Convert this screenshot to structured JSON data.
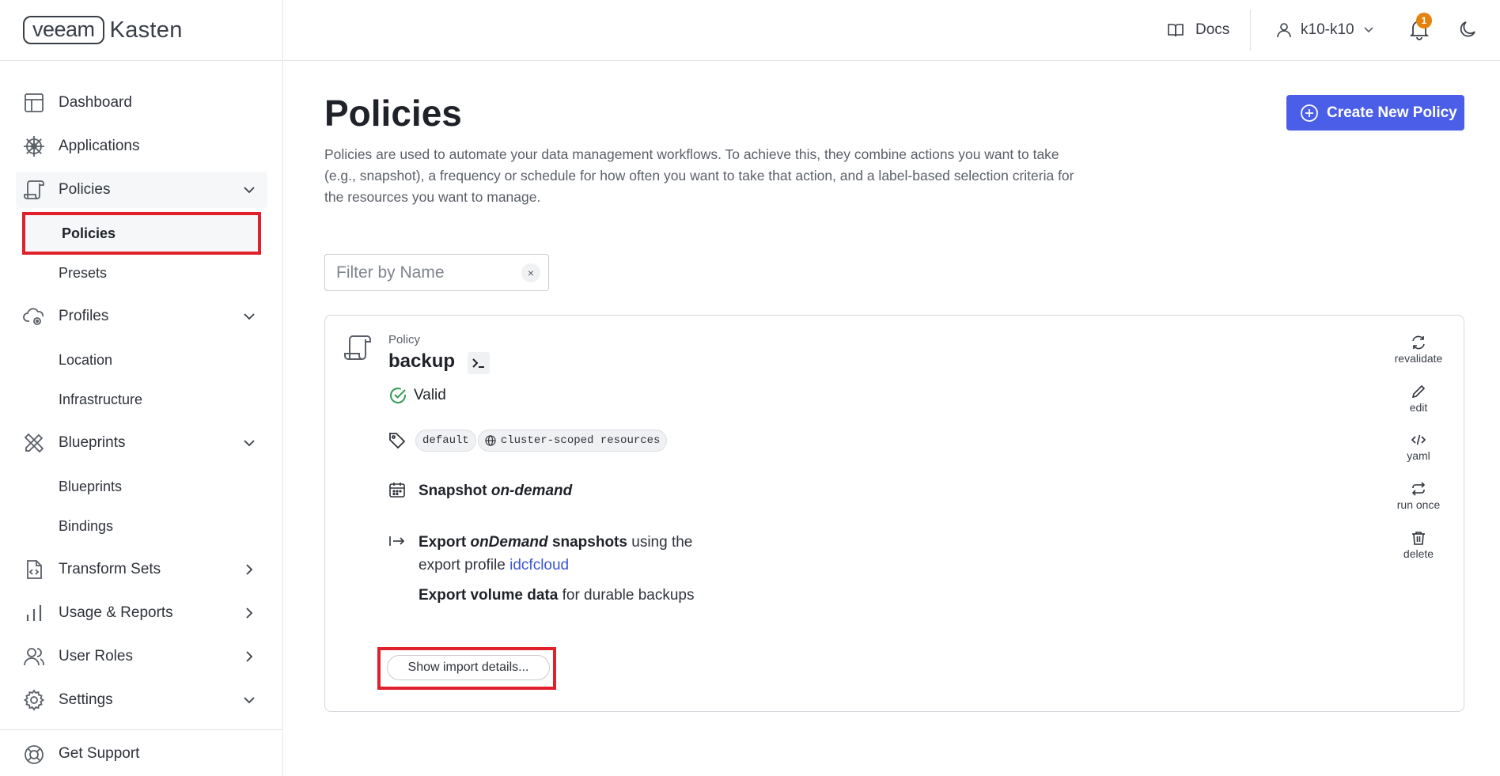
{
  "brand": {
    "veeam": "veeam",
    "kasten": "Kasten"
  },
  "sidebar": {
    "items": [
      {
        "label": "Dashboard"
      },
      {
        "label": "Applications"
      },
      {
        "label": "Policies"
      },
      {
        "label": "Profiles"
      },
      {
        "label": "Blueprints"
      },
      {
        "label": "Transform Sets"
      },
      {
        "label": "Usage & Reports"
      },
      {
        "label": "User Roles"
      },
      {
        "label": "Settings"
      }
    ],
    "policies_sub": [
      "Policies",
      "Presets"
    ],
    "profiles_sub": [
      "Location",
      "Infrastructure"
    ],
    "blueprints_sub": [
      "Blueprints",
      "Bindings"
    ],
    "support": "Get Support"
  },
  "topbar": {
    "docs": "Docs",
    "user": "k10-k10",
    "notifications_count": "1"
  },
  "main": {
    "title": "Policies",
    "description": "Policies are used to automate your data management workflows. To achieve this, they combine actions you want to take (e.g., snapshot), a frequency or schedule for how often you want to take that action, and a label-based selection criteria for the resources you want to manage.",
    "create_button": "Create New Policy",
    "filter_placeholder": "Filter by Name",
    "filter_clear": "×"
  },
  "policy": {
    "kind": "Policy",
    "name": "backup",
    "status": "Valid",
    "tags": [
      "default",
      "cluster-scoped resources"
    ],
    "snapshot": {
      "action": "Snapshot",
      "frequency": "on-demand"
    },
    "export": {
      "action": "Export",
      "which": "onDemand",
      "what": "snapshots",
      "using": "using the",
      "profile_prefix": "export profile",
      "profile": "idcfcloud",
      "volume": "Export volume data",
      "volume_suffix": "for durable backups"
    },
    "import_button": "Show import details...",
    "actions": [
      "revalidate",
      "edit",
      "yaml",
      "run once",
      "delete"
    ]
  },
  "colors": {
    "accent": "#4a5ee8",
    "highlight": "#e0202a",
    "valid": "#2e9b4e",
    "badge": "#e4820c",
    "link": "#3a56d4"
  }
}
